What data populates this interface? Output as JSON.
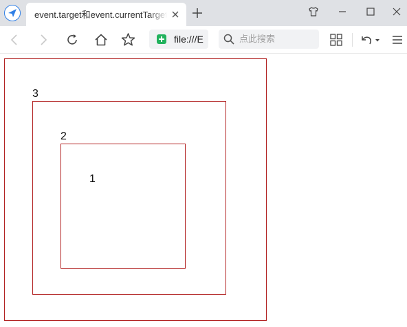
{
  "tab": {
    "title": "event.target和event.currentTarget"
  },
  "toolbar": {
    "address_text": "file:///E",
    "search_placeholder": "点此搜索"
  },
  "page": {
    "boxes": [
      {
        "label": "3"
      },
      {
        "label": "2"
      },
      {
        "label": "1"
      }
    ]
  },
  "colors": {
    "box_border": "#b22222",
    "secure_badge": "#22b25d",
    "browser_logo": "#2f7fe6"
  },
  "icons": {
    "browser_logo": "paper-plane-compass-icon",
    "tab_close": "close-icon",
    "new_tab": "plus-icon",
    "skin": "shirt-icon",
    "minimize": "minimize-icon",
    "maximize": "maximize-icon",
    "close_window": "close-icon",
    "back": "chevron-left-icon",
    "forward": "chevron-right-icon",
    "reload": "reload-icon",
    "home": "home-icon",
    "bookmark": "star-icon",
    "secure": "secure-shield-icon",
    "search": "search-icon",
    "apps": "apps-grid-icon",
    "undo": "undo-icon",
    "menu": "hamburger-menu-icon"
  }
}
